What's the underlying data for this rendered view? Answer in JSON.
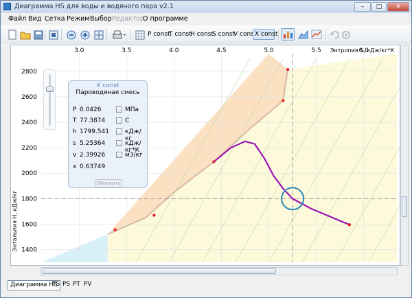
{
  "window": {
    "title": "Диаграмма HS для воды и водяного пара v2.1",
    "minimize_glyph": "–",
    "maximize_glyph": "□",
    "close_glyph": "✕"
  },
  "menu": [
    {
      "label": "Файл",
      "enabled": true
    },
    {
      "label": "Вид",
      "enabled": true
    },
    {
      "label": "Сетка",
      "enabled": true
    },
    {
      "label": "Режим",
      "enabled": true
    },
    {
      "label": "Выбор",
      "enabled": true
    },
    {
      "label": "Редактор",
      "enabled": false
    },
    {
      "label": "О программе",
      "enabled": true
    }
  ],
  "toolbar": {
    "line_buttons": [
      "P const",
      "T const",
      "H const",
      "S const",
      "V const",
      "X const"
    ],
    "selected_line": "X const"
  },
  "panel": {
    "header": "X const",
    "title": "Пароводяная смесь",
    "rows": [
      {
        "label": "P",
        "value": "0.0426",
        "unit": "МПа"
      },
      {
        "label": "T",
        "value": "77.3874",
        "unit": "С"
      },
      {
        "label": "h",
        "value": "1799.541",
        "unit": "кДж/кг"
      },
      {
        "label": "s",
        "value": "5.25364",
        "unit": "кДж/кг*К"
      },
      {
        "label": "v",
        "value": "2.39926",
        "unit": "м3/кг"
      },
      {
        "label": "x",
        "value": "0.63749",
        "unit": ""
      }
    ],
    "button": "Обновить"
  },
  "tabs": [
    "Диаграмма HS",
    "TS",
    "PS",
    "PT",
    "PV"
  ],
  "active_tab": "Диаграмма HS",
  "chart_data": {
    "type": "line",
    "xlabel": "Энтропия S, кДж/кг*К",
    "ylabel": "Энтальпия H, кДж/кг",
    "x_ticks": [
      3.0,
      3.5,
      4.0,
      4.5,
      5.0,
      5.5,
      6.0
    ],
    "y_ticks": [
      1400,
      1600,
      1800,
      2000,
      2200,
      2400,
      2600,
      2800
    ],
    "xlim": [
      2.6,
      6.35
    ],
    "ylim": [
      1300,
      2940
    ],
    "crosshair": {
      "x": 5.25,
      "y": 1800
    },
    "selected_point": {
      "x": 5.25,
      "y": 1800
    },
    "highlighted_x_line": [
      {
        "x": 4.42,
        "y": 2090
      },
      {
        "x": 4.6,
        "y": 2200
      },
      {
        "x": 4.75,
        "y": 2250
      },
      {
        "x": 4.85,
        "y": 2230
      },
      {
        "x": 4.95,
        "y": 2120
      },
      {
        "x": 5.05,
        "y": 1980
      },
      {
        "x": 5.15,
        "y": 1880
      },
      {
        "x": 5.25,
        "y": 1800
      },
      {
        "x": 5.45,
        "y": 1720
      },
      {
        "x": 5.85,
        "y": 1595
      }
    ],
    "marker_points": [
      {
        "x": 3.38,
        "y": 1555
      },
      {
        "x": 3.79,
        "y": 1670
      },
      {
        "x": 4.42,
        "y": 2090
      },
      {
        "x": 5.15,
        "y": 2570
      },
      {
        "x": 5.2,
        "y": 2815
      },
      {
        "x": 5.85,
        "y": 1595
      }
    ],
    "colors": {
      "highlight": "#9a16b0",
      "marker": "#e0262a",
      "circle": "#2a88b5",
      "fill_yellow": "#fdfadc",
      "fill_orange": "#fbe1c2",
      "fill_blue": "#d8f0f8"
    }
  }
}
